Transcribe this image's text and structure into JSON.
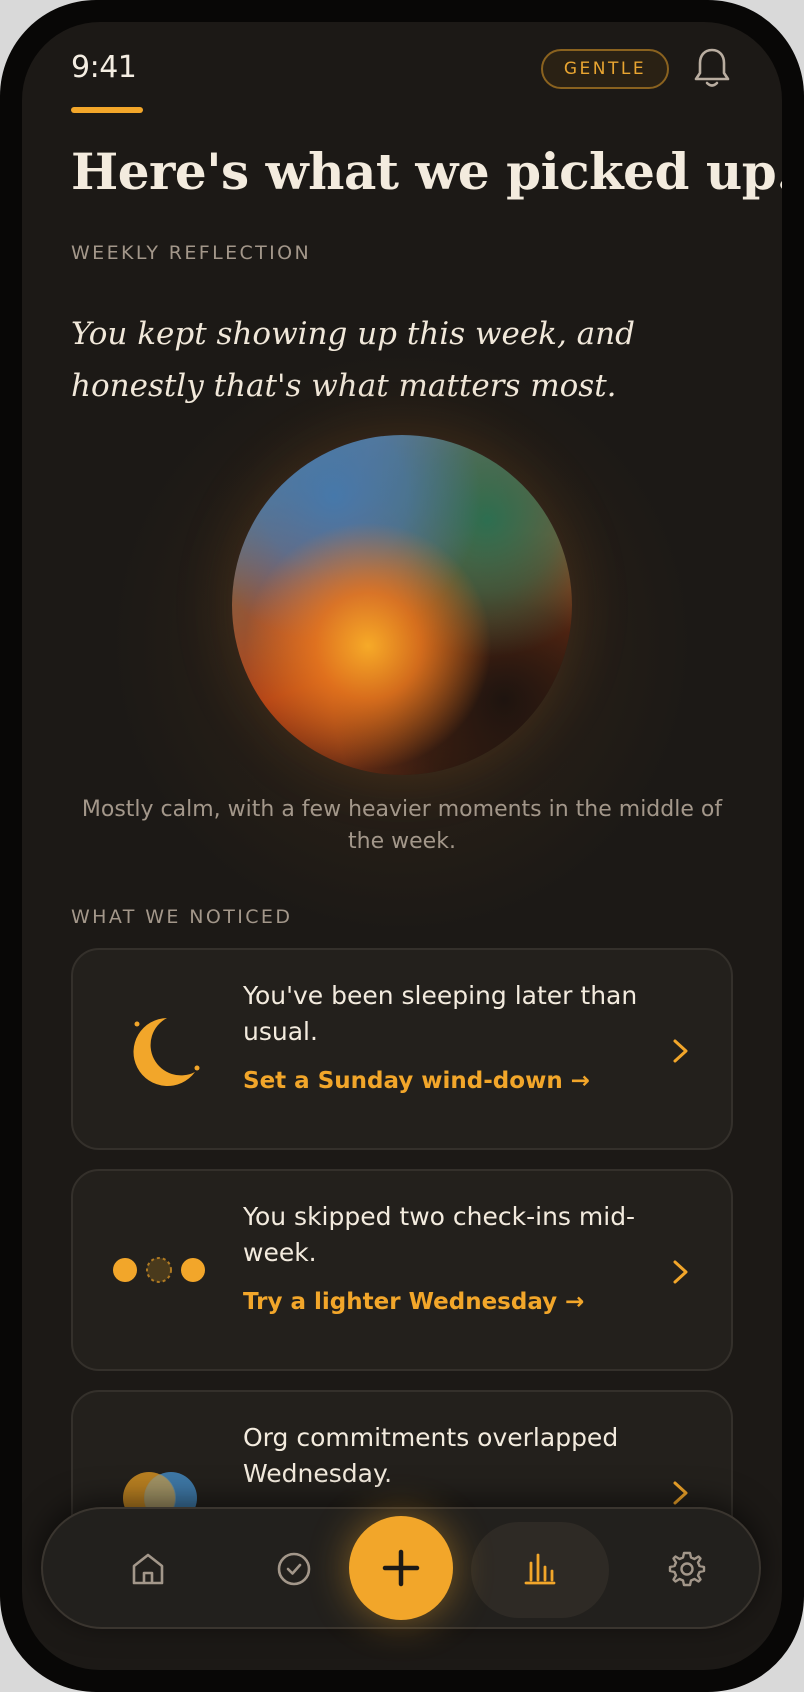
{
  "status_bar": {
    "time": "9:41",
    "mode_badge": "GENTLE"
  },
  "header": {
    "title": "Here's what we picked up."
  },
  "reflection": {
    "label": "WEEKLY REFLECTION",
    "quote": "You kept showing up this week, and honestly that's what matters most.",
    "orb_caption": "Mostly calm, with a few heavier moments in the middle of the week."
  },
  "noticed": {
    "label": "WHAT WE NOTICED",
    "cards": [
      {
        "icon": "moon-icon",
        "text": "You've been sleeping later than usual.",
        "action": "Set a Sunday wind-down →"
      },
      {
        "icon": "skipped-dots-icon",
        "text": "You skipped two check-ins mid-week.",
        "action": "Try a lighter Wednesday →"
      },
      {
        "icon": "overlap-circles-icon",
        "text": "Org commitments overlapped Wednesday.",
        "action": ""
      }
    ]
  },
  "nav": {
    "items": [
      "home-icon",
      "check-circle-icon",
      "plus-icon",
      "bar-chart-icon",
      "gear-icon"
    ],
    "active": "bar-chart-icon"
  },
  "colors": {
    "accent": "#f2a62a",
    "background": "#1c1916",
    "card": "#23201c",
    "text_primary": "#f3ebde",
    "text_muted": "#a3978a"
  }
}
